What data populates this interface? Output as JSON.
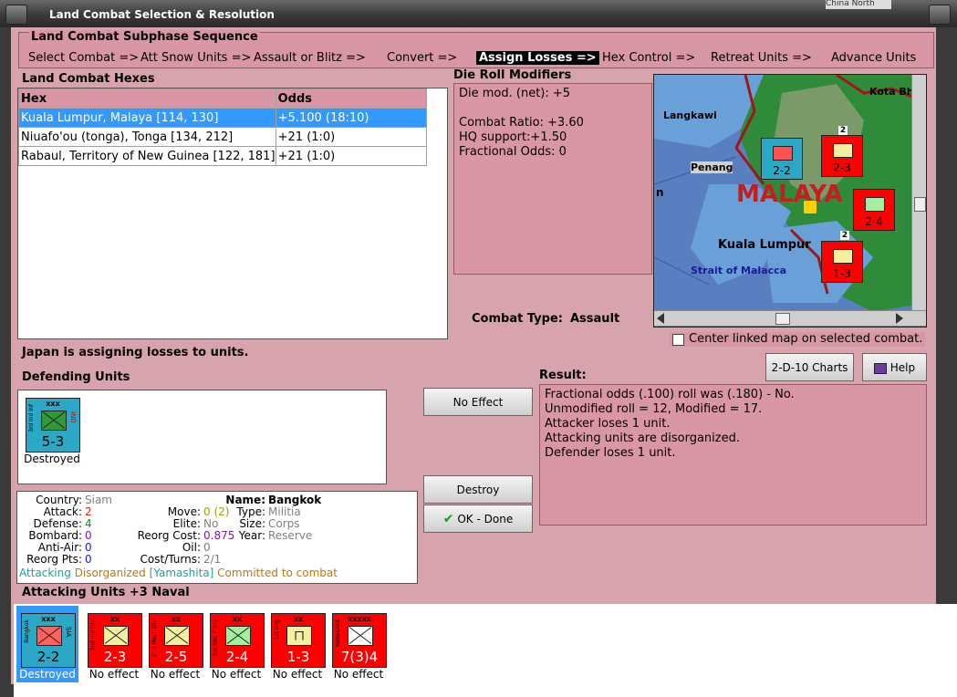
{
  "window": {
    "title": "Land Combat Selection & Resolution",
    "background_tab": "China North"
  },
  "sequence": {
    "title": "Land Combat Subphase Sequence",
    "steps": [
      "Select Combat =>",
      "Att Snow Units =>",
      "Assault or Blitz =>",
      "Convert =>",
      "Assign Losses =>",
      "Hex Control =>",
      "Retreat Units =>",
      "Advance Units"
    ],
    "active_index": 4
  },
  "hexes": {
    "title": "Land Combat Hexes",
    "columns": [
      "Hex",
      "Odds"
    ],
    "rows": [
      {
        "hex": "Kuala Lumpur, Malaya [114, 130]",
        "odds": "+5.100 (18:10)"
      },
      {
        "hex": "Niuafo'ou (tonga), Tonga [134, 212]",
        "odds": "+21 (1:0)"
      },
      {
        "hex": "Rabaul, Territory of New Guinea [122, 181]",
        "odds": "+21 (1:0)"
      }
    ],
    "selected_index": 0
  },
  "modifiers": {
    "title": "Die Roll Modifiers",
    "lines": [
      "Die mod. (net): +5",
      "",
      "Combat Ratio: +3.60",
      "HQ support:+1.50",
      "Fractional Odds: 0"
    ]
  },
  "combat_type": {
    "label": "Combat Type:",
    "value": "Assault"
  },
  "map": {
    "labels": [
      "Langkawi",
      "Kota Bh",
      "Penang",
      "MALAYA",
      "Kuala Lumpur",
      "Strait of Malacca",
      "n"
    ],
    "counters": [
      {
        "value": "2-2",
        "color": "#2aa8c6"
      },
      {
        "value": "2-3",
        "color": "#ff0000"
      },
      {
        "value": "2-4",
        "color": "#ff0000"
      },
      {
        "value": "1-3",
        "color": "#ff0000"
      }
    ],
    "stack_marks": [
      "2",
      "2"
    ]
  },
  "center_map": {
    "label": "Center linked map on selected combat.",
    "checked": false
  },
  "status_line": "Japan is assigning losses to units.",
  "buttons": {
    "charts": "2-D-10 Charts",
    "help": "Help",
    "no_effect": "No Effect",
    "destroy": "Destroy",
    "ok_done": "OK - Done"
  },
  "defending": {
    "title": "Defending Units",
    "units": [
      {
        "side": "3rd Ind Inf",
        "size": "xxx",
        "value": "5-3",
        "nat": "IND",
        "status": "Destroyed",
        "color": "#2aa8c6"
      }
    ]
  },
  "result": {
    "title": "Result:",
    "lines": [
      "Fractional odds (.100) roll was (.180)  - No.",
      "Unmodified roll = 12, Modified = 17.",
      "Attacker loses 1 unit.",
      "Attacking units are disorganized.",
      "Defender loses 1 unit."
    ]
  },
  "unit_info": {
    "country_label": "Country:",
    "country": "Siam",
    "attack_label": "Attack:",
    "attack": "2",
    "defense_label": "Defense:",
    "defense": "4",
    "bombard_label": "Bombard:",
    "bombard": "0",
    "antiair_label": "Anti-Air:",
    "antiair": "0",
    "reorgpts_label": "Reorg Pts:",
    "reorgpts": "0",
    "move_label": "Move:",
    "move": "0 (2)",
    "elite_label": "Elite:",
    "elite": "No",
    "reorgcost_label": "Reorg Cost:",
    "reorgcost": "0.875",
    "oil_label": "Oil:",
    "oil": "0",
    "costturns_label": "Cost/Turns:",
    "costturns": "2/1",
    "name_label": "Name:",
    "name": "Bangkok",
    "type_label": "Type:",
    "type": "Militia",
    "size_label": "Size:",
    "size": "Corps",
    "year_label": "Year:",
    "year": "Reserve",
    "status_attacking": "Attacking",
    "status_disorg": "Disorganized",
    "status_hq": "[Yamashita]",
    "status_committed": "Committed to combat",
    "colors": {
      "attack": "#d81818",
      "defense": "#1a8a1a",
      "bombard": "#7a1ab0",
      "antiair": "#1a1ad8",
      "reorgpts": "#1a1ad8",
      "move": "#1a8a1a",
      "grey": "#808080",
      "teal": "#1aa0a0",
      "orange": "#c07800"
    }
  },
  "attacking": {
    "title": "Attacking Units +3 Naval",
    "units": [
      {
        "side": "Bangkok",
        "size": "xxx",
        "value": "2-2",
        "nat": "SIA",
        "status": "Destroyed",
        "color": "#2aa8c6"
      },
      {
        "side": "2nd Ind Div",
        "size": "xx",
        "value": "2-3",
        "nat": "",
        "status": "No effect",
        "color": "#ff0000"
      },
      {
        "side": "2nd Mech Div",
        "size": "xx",
        "value": "2-5",
        "nat": "",
        "status": "No effect",
        "color": "#ff0000"
      },
      {
        "side": "1st SNL F Div",
        "size": "xx",
        "value": "2-4",
        "nat": "",
        "status": "No effect",
        "color": "#ff0000"
      },
      {
        "side": "1st Eng",
        "size": "xx",
        "value": "1-3",
        "nat": "",
        "status": "No effect",
        "color": "#ff0000"
      },
      {
        "side": "Yamashita",
        "size": "xxxxx",
        "value": "7(3)4",
        "nat": "",
        "status": "No effect",
        "color": "#ff0000"
      }
    ]
  }
}
